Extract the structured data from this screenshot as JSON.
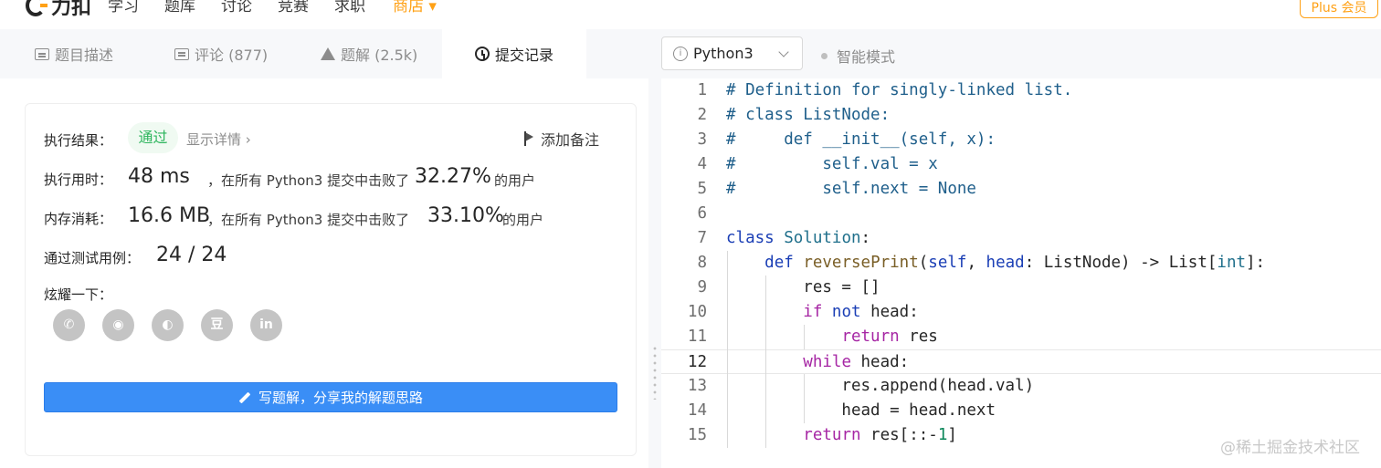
{
  "nav": {
    "logo": "力扣",
    "items": [
      "学习",
      "题库",
      "讨论",
      "竞赛",
      "求职"
    ],
    "store": "商店",
    "plus": "Plus 会员"
  },
  "tabs": [
    {
      "label": "题目描述",
      "icon": "description-icon"
    },
    {
      "label": "评论 (877)",
      "icon": "comment-icon"
    },
    {
      "label": "题解 (2.5k)",
      "icon": "flask-icon"
    },
    {
      "label": "提交记录",
      "icon": "clock-icon"
    }
  ],
  "toolbar": {
    "language": "Python3",
    "smart_mode": "智能模式"
  },
  "result": {
    "label": "执行结果：",
    "status": "通过",
    "detail": "显示详情 ›",
    "note": "添加备注",
    "runtime_label": "执行用时：",
    "runtime_value": "48 ms",
    "runtime_text": "，在所有 Python3 提交中击败了",
    "runtime_pct": "32.27%",
    "runtime_suffix": "的用户",
    "memory_label": "内存消耗：",
    "memory_value": "16.6 MB",
    "memory_text": "，在所有 Python3 提交中击败了",
    "memory_pct": "33.10%",
    "memory_suffix": "的用户",
    "tests_label": "通过测试用例：",
    "tests_value": "24 / 24",
    "share_label": "炫耀一下：",
    "share_icons": [
      "wechat-icon",
      "weibo-icon",
      "qq-icon",
      "douban-icon",
      "linkedin-icon"
    ],
    "share_glyphs": [
      "✆",
      "◉",
      "◐",
      "豆",
      "in"
    ],
    "write_button": "写题解，分享我的解题思路"
  },
  "code": {
    "current_line": 12,
    "lines": [
      "# Definition for singly-linked list.",
      "# class ListNode:",
      "#     def __init__(self, x):",
      "#         self.val = x",
      "#         self.next = None",
      "",
      "class Solution:",
      "    def reversePrint(self, head: ListNode) -> List[int]:",
      "        res = []",
      "        if not head:",
      "            return res",
      "        while head:",
      "            res.append(head.val)",
      "            head = head.next",
      "        return res[::-1]"
    ]
  },
  "watermark": "@稀土掘金技术社区"
}
